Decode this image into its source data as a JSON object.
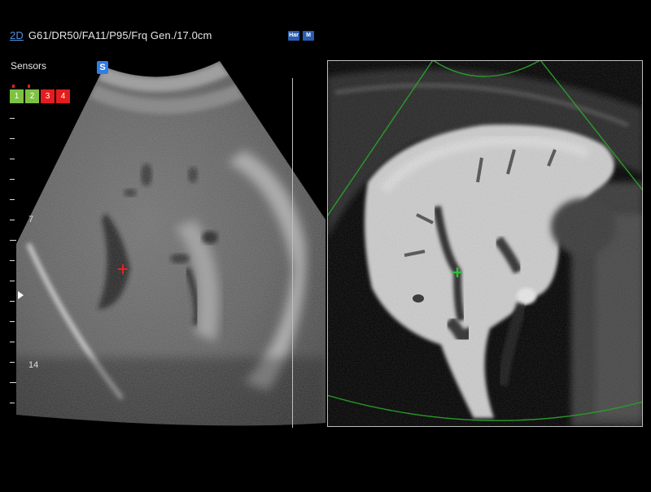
{
  "header": {
    "mode": "2D",
    "params": "G61/DR50/FA11/P95/Frq Gen./17.0cm",
    "icons": [
      {
        "name": "harmonic-icon",
        "glyph": "Har"
      },
      {
        "name": "m-mode-icon",
        "glyph": "M"
      }
    ]
  },
  "sensors": {
    "title": "Sensors",
    "badge": "S",
    "items": [
      {
        "label": "1",
        "color": "#7ec243",
        "active": true
      },
      {
        "label": "2",
        "color": "#7ec243",
        "active": true
      },
      {
        "label": "3",
        "color": "#e21d1d",
        "active": false
      },
      {
        "label": "4",
        "color": "#e21d1d",
        "active": false
      }
    ]
  },
  "depth_scale": {
    "labels": [
      "7",
      "14"
    ]
  },
  "markers": {
    "ultrasound_cross_color": "#e82020",
    "mri_cross_color": "#2fbf3a",
    "sector_outline_color": "#2a9b2a"
  }
}
